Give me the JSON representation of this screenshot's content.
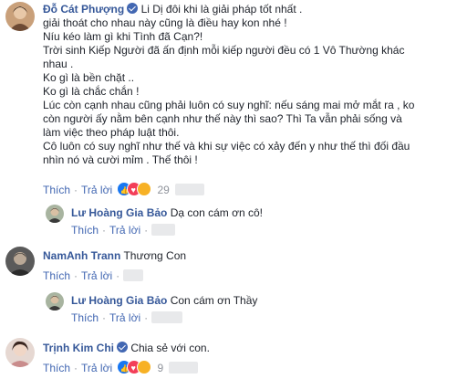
{
  "comments": [
    {
      "author": "Đỗ Cát Phượng",
      "verified": true,
      "lines": [
        "Li Dị đôi khi là giải pháp tốt nhất .",
        "giải thoát cho nhau này cũng là điều hay kon nhé !",
        "Níu kéo làm gì khi Tình đã Cạn?!",
        "Trời sinh Kiếp Người đã ấn định mỗi kiếp người đều có 1 Vô Thường khác",
        "nhau .",
        "Ko gì là bền chặt ..",
        "Ko gì là chắc chắn !",
        "Lúc còn cạnh nhau cũng phải luôn có suy nghĩ: nếu sáng mai mở mắt ra , ko",
        "còn người ấy nằm bên cạnh như thế này thì sao? Thì Ta vẫn phải sống và",
        "làm việc theo pháp luật thôi.",
        "Cô luôn có suy nghĩ như thế và khi sự việc có xảy đến y như thế thì đối đầu",
        "nhìn nó và cười mỉm . Thế thôi !"
      ],
      "actions": {
        "like": "Thích",
        "reply": "Trả lời",
        "count": "29"
      }
    },
    {
      "author": "Lư Hoàng Gia Bảo",
      "text": "Dạ con cám ơn cô!",
      "actions": {
        "like": "Thích",
        "reply": "Trả lời"
      }
    },
    {
      "author": "NamAnh Trann",
      "text": "Thương Con",
      "actions": {
        "like": "Thích",
        "reply": "Trả lời"
      }
    },
    {
      "author": "Lư Hoàng Gia Bảo",
      "text": "Con cám ơn Thầy",
      "actions": {
        "like": "Thích",
        "reply": "Trả lời"
      }
    },
    {
      "author": "Trịnh Kim Chi",
      "verified": true,
      "text": "Chia sẻ với con.",
      "actions": {
        "like": "Thích",
        "reply": "Trả lời",
        "count": "9"
      }
    }
  ],
  "colors": {
    "link": "#365899",
    "action": "#4267b2",
    "meta": "#90949c",
    "like": "#1877f2",
    "love": "#f33e58",
    "wow": "#f7b125"
  },
  "icons": [
    "verified-badge-icon",
    "like-reaction-icon",
    "love-reaction-icon",
    "wow-reaction-icon"
  ]
}
